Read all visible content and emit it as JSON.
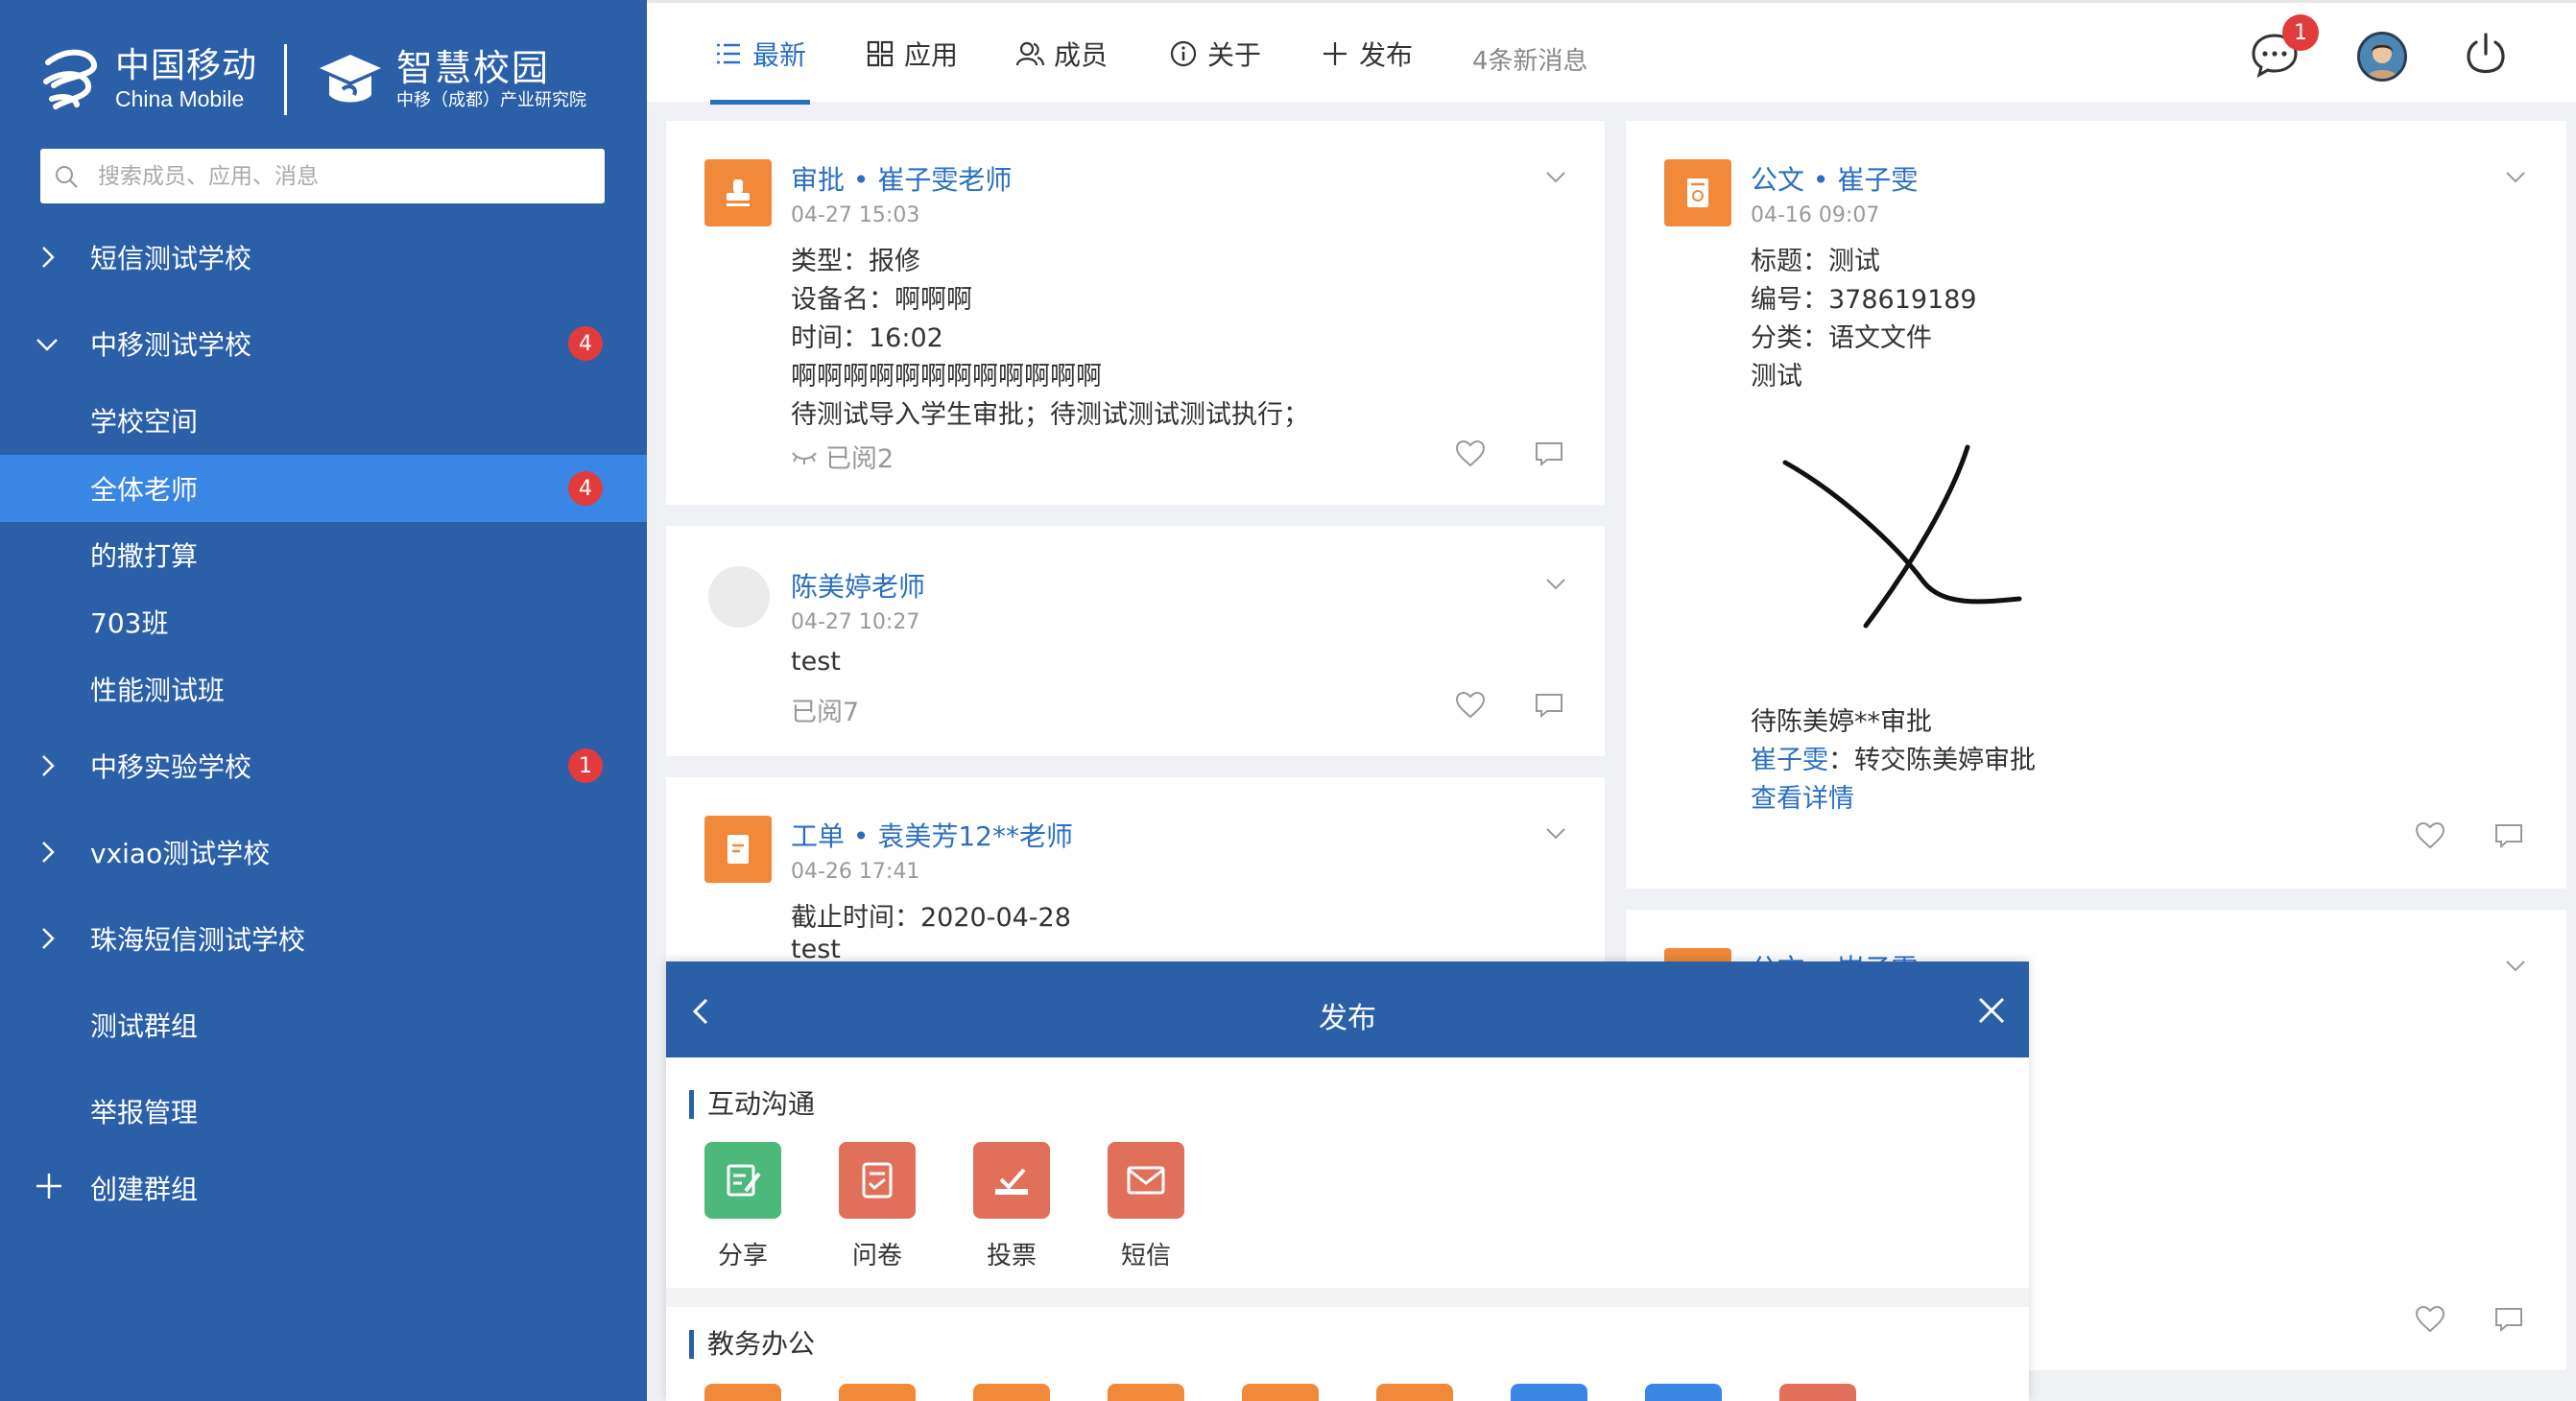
{
  "brand": {
    "cm_zh": "中国移动",
    "cm_en": "China Mobile",
    "campus_zh": "智慧校园",
    "campus_sub": "中移（成都）产业研究院"
  },
  "search": {
    "placeholder": "搜索成员、应用、消息"
  },
  "sidebar": {
    "items": [
      {
        "label": "短信测试学校"
      },
      {
        "label": "中移测试学校",
        "badge": "4"
      },
      {
        "label": "学校空间"
      },
      {
        "label": "全体老师",
        "badge": "4"
      },
      {
        "label": "的撒打算"
      },
      {
        "label": "703班"
      },
      {
        "label": "性能测试班"
      },
      {
        "label": "中移实验学校",
        "badge": "1"
      },
      {
        "label": "vxiao测试学校"
      },
      {
        "label": "珠海短信测试学校"
      },
      {
        "label": "测试群组"
      },
      {
        "label": "举报管理"
      },
      {
        "label": "创建群组"
      }
    ]
  },
  "topbar": {
    "tabs": [
      {
        "label": "最新",
        "icon": "list-icon"
      },
      {
        "label": "应用",
        "icon": "grid-icon"
      },
      {
        "label": "成员",
        "icon": "members-icon"
      },
      {
        "label": "关于",
        "icon": "info-icon"
      },
      {
        "label": "发布",
        "icon": "plus-icon"
      }
    ],
    "new_messages": "4条新消息",
    "chat_badge": "1"
  },
  "cards": {
    "c1": {
      "title": "审批 • 崔子雯老师",
      "time": "04-27 15:03",
      "lines": [
        "类型：报修",
        "设备名：啊啊啊",
        "时间：16:02",
        "啊啊啊啊啊啊啊啊啊啊啊啊",
        "待测试导入学生审批；待测试测试测试执行；"
      ],
      "read": "已阅2"
    },
    "c2": {
      "title": "陈美婷老师",
      "time": "04-27 10:27",
      "lines": [
        "test"
      ],
      "read": "已阅7"
    },
    "c3": {
      "title": "工单 • 袁美芳12**老师",
      "time": "04-26 17:41",
      "lines": [
        "截止时间：2020-04-28",
        "test"
      ]
    },
    "c4": {
      "title": "公文 • 崔子雯",
      "time": "04-16 09:07",
      "lines": [
        "标题：测试",
        "编号：378619189",
        "分类：语文文件",
        "测试"
      ],
      "status": "待陈美婷**审批",
      "transfer_name": "崔子雯",
      "transfer_text": "：转交陈美婷审批",
      "detail_link": "查看详情"
    },
    "c5": {
      "title": "公文 • 崔子雯"
    }
  },
  "publish": {
    "title": "发布",
    "section1": {
      "title": "互动沟通",
      "items": [
        {
          "label": "分享",
          "color": "#4cb87a"
        },
        {
          "label": "问卷",
          "color": "#e0705a"
        },
        {
          "label": "投票",
          "color": "#e0705a"
        },
        {
          "label": "短信",
          "color": "#e0705a"
        }
      ]
    },
    "section2": {
      "title": "教务办公"
    }
  }
}
